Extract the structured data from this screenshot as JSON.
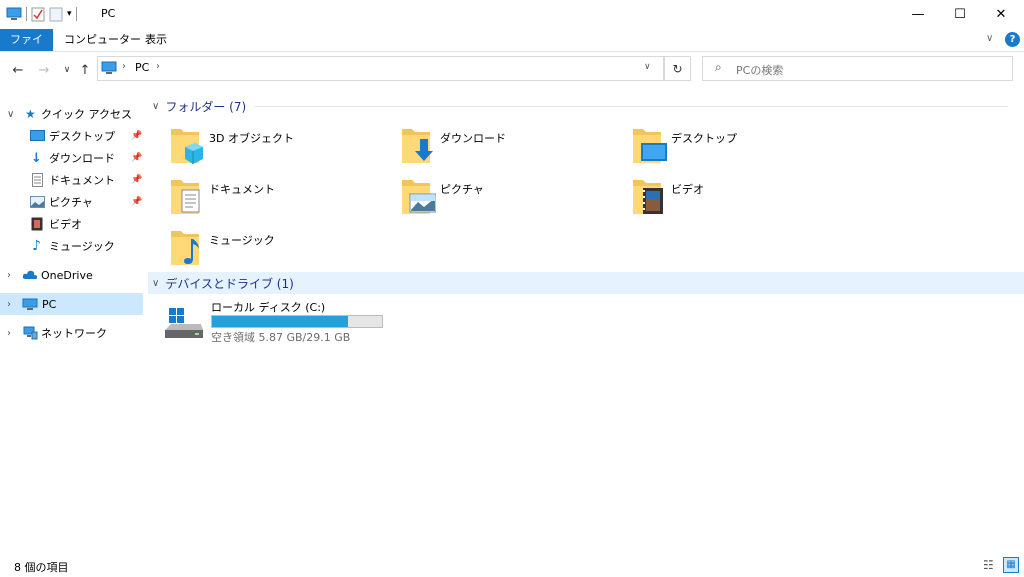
{
  "window": {
    "title": "PC"
  },
  "ribbon": {
    "tabs": [
      "ファイル",
      "コンピューター",
      "表示"
    ]
  },
  "address": {
    "path_root": "PC"
  },
  "search": {
    "placeholder": "PCの検索"
  },
  "nav": {
    "quick_access": "クイック アクセス",
    "quick_items": [
      "デスクトップ",
      "ダウンロード",
      "ドキュメント",
      "ピクチャ",
      "ビデオ",
      "ミュージック"
    ],
    "onedrive": "OneDrive",
    "pc": "PC",
    "network": "ネットワーク"
  },
  "content": {
    "folders_header": "フォルダー (7)",
    "folders": [
      "3D オブジェクト",
      "ダウンロード",
      "デスクトップ",
      "ドキュメント",
      "ピクチャ",
      "ビデオ",
      "ミュージック"
    ],
    "devices_header": "デバイスとドライブ (1)",
    "drive": {
      "name": "ローカル ディスク (C:)",
      "free_text": "空き領域 5.87 GB/29.1 GB",
      "used_fraction": 0.8
    }
  },
  "status": {
    "items_count": "8 個の項目"
  }
}
